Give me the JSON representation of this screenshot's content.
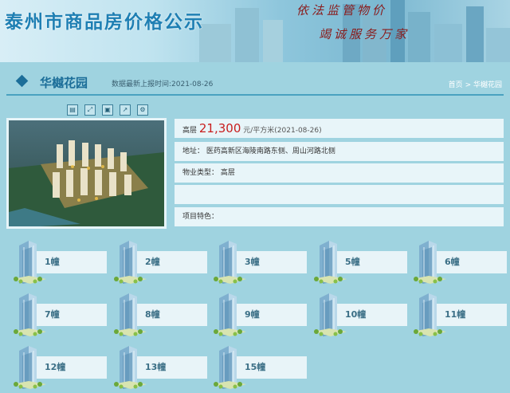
{
  "banner": {
    "title": "泰州市商品房价格公示",
    "slogan1": "依法监管物价",
    "slogan2": "竭诚服务万家"
  },
  "project": {
    "name": "华樾花园",
    "update_text": "数据最新上报时间:2021-08-26",
    "breadcrumb_home": "首页",
    "breadcrumb_sep": ">",
    "breadcrumb_current": "华樾花园"
  },
  "toolbar_icons": [
    "document-icon",
    "expand-icon",
    "save-icon",
    "share-icon",
    "settings-icon"
  ],
  "info": {
    "price_prefix": "高层",
    "price_value": "21,300",
    "price_unit": "元/平方米(2021-08-26)",
    "address": "地址：  医药高新区海陵南路东侧、周山河路北侧",
    "property_type": "物业类型：  高层",
    "empty_row": "",
    "features": "项目特色："
  },
  "buildings": [
    "1幢",
    "2幢",
    "3幢",
    "5幢",
    "6幢",
    "7幢",
    "8幢",
    "9幢",
    "10幢",
    "11幢",
    "12幢",
    "13幢",
    "15幢"
  ]
}
